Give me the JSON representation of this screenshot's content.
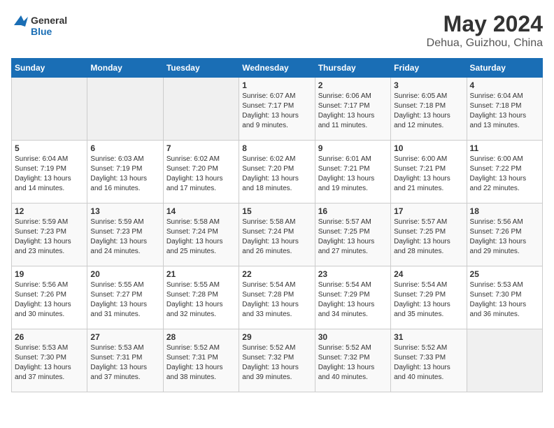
{
  "header": {
    "logo": {
      "text_general": "General",
      "text_blue": "Blue"
    },
    "title": "May 2024",
    "subtitle": "Dehua, Guizhou, China"
  },
  "calendar": {
    "days_of_week": [
      "Sunday",
      "Monday",
      "Tuesday",
      "Wednesday",
      "Thursday",
      "Friday",
      "Saturday"
    ],
    "weeks": [
      [
        {
          "day": "",
          "info": ""
        },
        {
          "day": "",
          "info": ""
        },
        {
          "day": "",
          "info": ""
        },
        {
          "day": "1",
          "info": "Sunrise: 6:07 AM\nSunset: 7:17 PM\nDaylight: 13 hours and 9 minutes."
        },
        {
          "day": "2",
          "info": "Sunrise: 6:06 AM\nSunset: 7:17 PM\nDaylight: 13 hours and 11 minutes."
        },
        {
          "day": "3",
          "info": "Sunrise: 6:05 AM\nSunset: 7:18 PM\nDaylight: 13 hours and 12 minutes."
        },
        {
          "day": "4",
          "info": "Sunrise: 6:04 AM\nSunset: 7:18 PM\nDaylight: 13 hours and 13 minutes."
        }
      ],
      [
        {
          "day": "5",
          "info": "Sunrise: 6:04 AM\nSunset: 7:19 PM\nDaylight: 13 hours and 14 minutes."
        },
        {
          "day": "6",
          "info": "Sunrise: 6:03 AM\nSunset: 7:19 PM\nDaylight: 13 hours and 16 minutes."
        },
        {
          "day": "7",
          "info": "Sunrise: 6:02 AM\nSunset: 7:20 PM\nDaylight: 13 hours and 17 minutes."
        },
        {
          "day": "8",
          "info": "Sunrise: 6:02 AM\nSunset: 7:20 PM\nDaylight: 13 hours and 18 minutes."
        },
        {
          "day": "9",
          "info": "Sunrise: 6:01 AM\nSunset: 7:21 PM\nDaylight: 13 hours and 19 minutes."
        },
        {
          "day": "10",
          "info": "Sunrise: 6:00 AM\nSunset: 7:21 PM\nDaylight: 13 hours and 21 minutes."
        },
        {
          "day": "11",
          "info": "Sunrise: 6:00 AM\nSunset: 7:22 PM\nDaylight: 13 hours and 22 minutes."
        }
      ],
      [
        {
          "day": "12",
          "info": "Sunrise: 5:59 AM\nSunset: 7:23 PM\nDaylight: 13 hours and 23 minutes."
        },
        {
          "day": "13",
          "info": "Sunrise: 5:59 AM\nSunset: 7:23 PM\nDaylight: 13 hours and 24 minutes."
        },
        {
          "day": "14",
          "info": "Sunrise: 5:58 AM\nSunset: 7:24 PM\nDaylight: 13 hours and 25 minutes."
        },
        {
          "day": "15",
          "info": "Sunrise: 5:58 AM\nSunset: 7:24 PM\nDaylight: 13 hours and 26 minutes."
        },
        {
          "day": "16",
          "info": "Sunrise: 5:57 AM\nSunset: 7:25 PM\nDaylight: 13 hours and 27 minutes."
        },
        {
          "day": "17",
          "info": "Sunrise: 5:57 AM\nSunset: 7:25 PM\nDaylight: 13 hours and 28 minutes."
        },
        {
          "day": "18",
          "info": "Sunrise: 5:56 AM\nSunset: 7:26 PM\nDaylight: 13 hours and 29 minutes."
        }
      ],
      [
        {
          "day": "19",
          "info": "Sunrise: 5:56 AM\nSunset: 7:26 PM\nDaylight: 13 hours and 30 minutes."
        },
        {
          "day": "20",
          "info": "Sunrise: 5:55 AM\nSunset: 7:27 PM\nDaylight: 13 hours and 31 minutes."
        },
        {
          "day": "21",
          "info": "Sunrise: 5:55 AM\nSunset: 7:28 PM\nDaylight: 13 hours and 32 minutes."
        },
        {
          "day": "22",
          "info": "Sunrise: 5:54 AM\nSunset: 7:28 PM\nDaylight: 13 hours and 33 minutes."
        },
        {
          "day": "23",
          "info": "Sunrise: 5:54 AM\nSunset: 7:29 PM\nDaylight: 13 hours and 34 minutes."
        },
        {
          "day": "24",
          "info": "Sunrise: 5:54 AM\nSunset: 7:29 PM\nDaylight: 13 hours and 35 minutes."
        },
        {
          "day": "25",
          "info": "Sunrise: 5:53 AM\nSunset: 7:30 PM\nDaylight: 13 hours and 36 minutes."
        }
      ],
      [
        {
          "day": "26",
          "info": "Sunrise: 5:53 AM\nSunset: 7:30 PM\nDaylight: 13 hours and 37 minutes."
        },
        {
          "day": "27",
          "info": "Sunrise: 5:53 AM\nSunset: 7:31 PM\nDaylight: 13 hours and 37 minutes."
        },
        {
          "day": "28",
          "info": "Sunrise: 5:52 AM\nSunset: 7:31 PM\nDaylight: 13 hours and 38 minutes."
        },
        {
          "day": "29",
          "info": "Sunrise: 5:52 AM\nSunset: 7:32 PM\nDaylight: 13 hours and 39 minutes."
        },
        {
          "day": "30",
          "info": "Sunrise: 5:52 AM\nSunset: 7:32 PM\nDaylight: 13 hours and 40 minutes."
        },
        {
          "day": "31",
          "info": "Sunrise: 5:52 AM\nSunset: 7:33 PM\nDaylight: 13 hours and 40 minutes."
        },
        {
          "day": "",
          "info": ""
        }
      ]
    ]
  }
}
